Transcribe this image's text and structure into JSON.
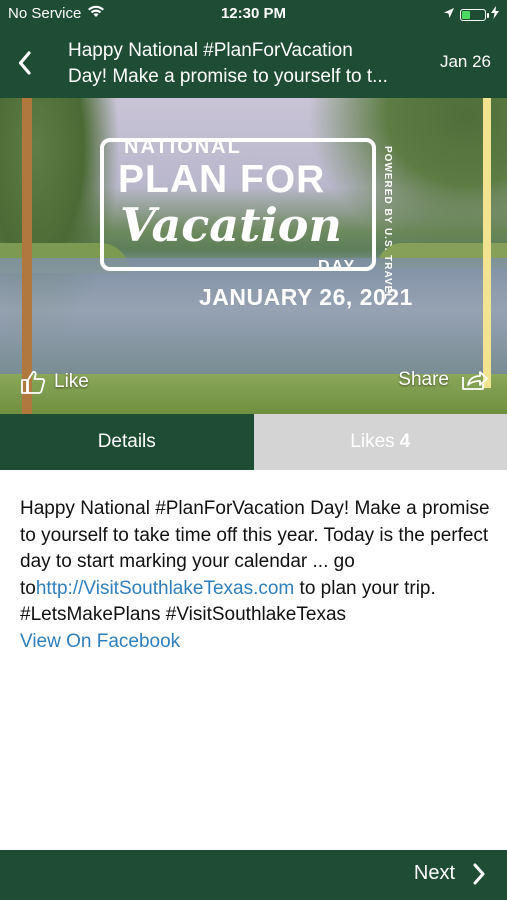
{
  "status_bar": {
    "carrier": "No Service",
    "time": "12:30 PM"
  },
  "header": {
    "title_line1": "Happy National #PlanForVacation",
    "title_line2": "Day! Make a promise to yourself to t...",
    "date": "Jan 26"
  },
  "hero": {
    "logo_national": "NATIONAL",
    "logo_plan": "PLAN FOR",
    "logo_vacation": "Vacation",
    "logo_day": "DAY",
    "logo_powered": "POWERED BY U.S. TRAVEL",
    "logo_date": "JANUARY 26, 2021",
    "like_label": "Like",
    "share_label": "Share"
  },
  "tabs": {
    "details": "Details",
    "likes_label": "Likes",
    "likes_count": "4"
  },
  "post": {
    "text_before_link": "Happy National #PlanForVacation Day! Make a promise to yourself to take time off this year. Today is the perfect day to start marking your calendar ... go to",
    "link": "http://VisitSouthlakeTexas.com",
    "text_after_link": " to plan your trip. #LetsMakePlans #VisitSouthlakeTexas",
    "facebook_link": "View On Facebook"
  },
  "footer": {
    "next_label": "Next"
  },
  "colors": {
    "brand_green": "#1e4d33",
    "link_blue": "#2f7fbd",
    "inactive_tab": "#d4d4d4"
  }
}
